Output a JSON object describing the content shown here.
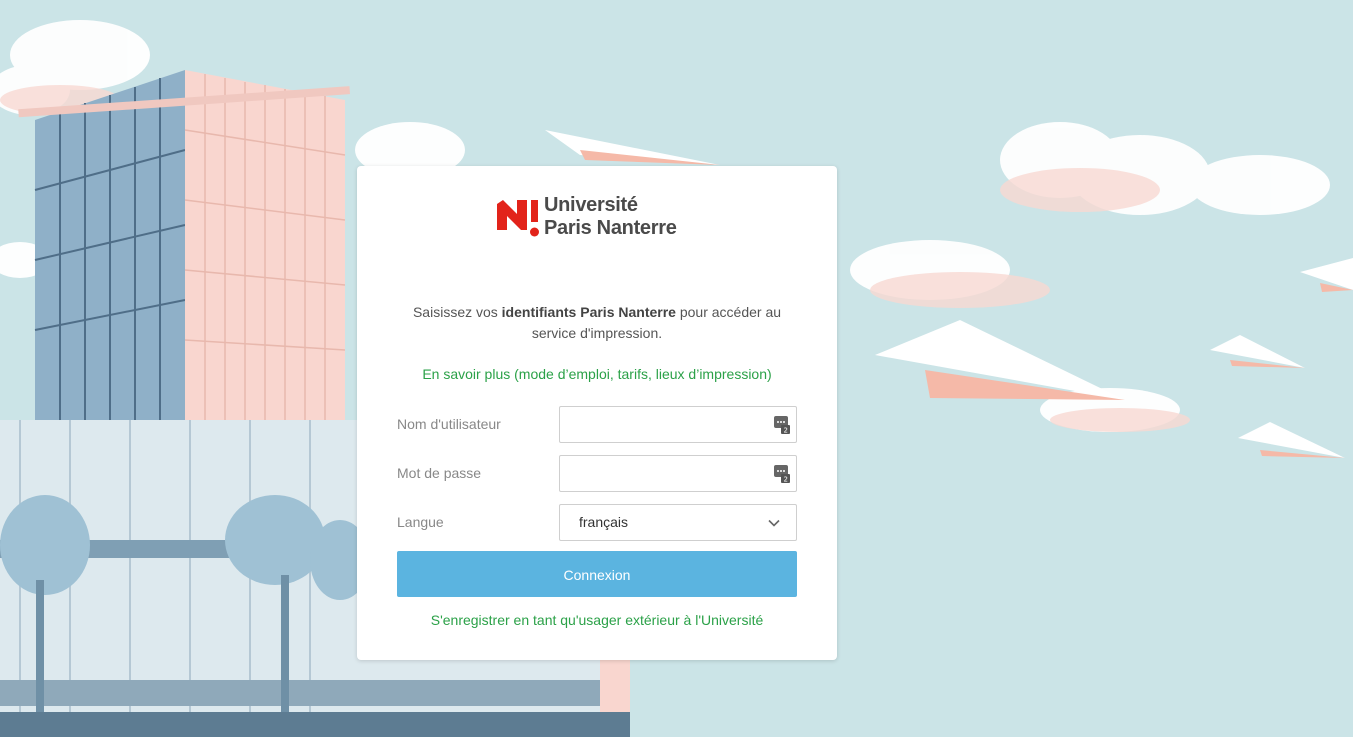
{
  "branding": {
    "logo_line1": "Université",
    "logo_line2": "Paris Nanterre",
    "brand_color": "#e2231a"
  },
  "intro": {
    "text_before": "Saisissez vos ",
    "text_bold": "identifiants Paris Nanterre",
    "text_after": " pour accéder au service d'impression."
  },
  "learn_more_link": "En savoir plus (mode d’emploi, tarifs, lieux d’impression)",
  "form": {
    "username_label": "Nom d'utilisateur",
    "username_value": "",
    "password_label": "Mot de passe",
    "password_value": "",
    "language_label": "Langue",
    "language_selected": "français",
    "submit_label": "Connexion"
  },
  "register_link": "S'enregistrer en tant qu'usager extérieur à l'Université",
  "icons": {
    "password_manager": "password-manager-icon",
    "dropdown": "chevron-down-icon"
  },
  "colors": {
    "button": "#5bb4e0",
    "link": "#2ba148",
    "background": "#cbe4e7"
  }
}
